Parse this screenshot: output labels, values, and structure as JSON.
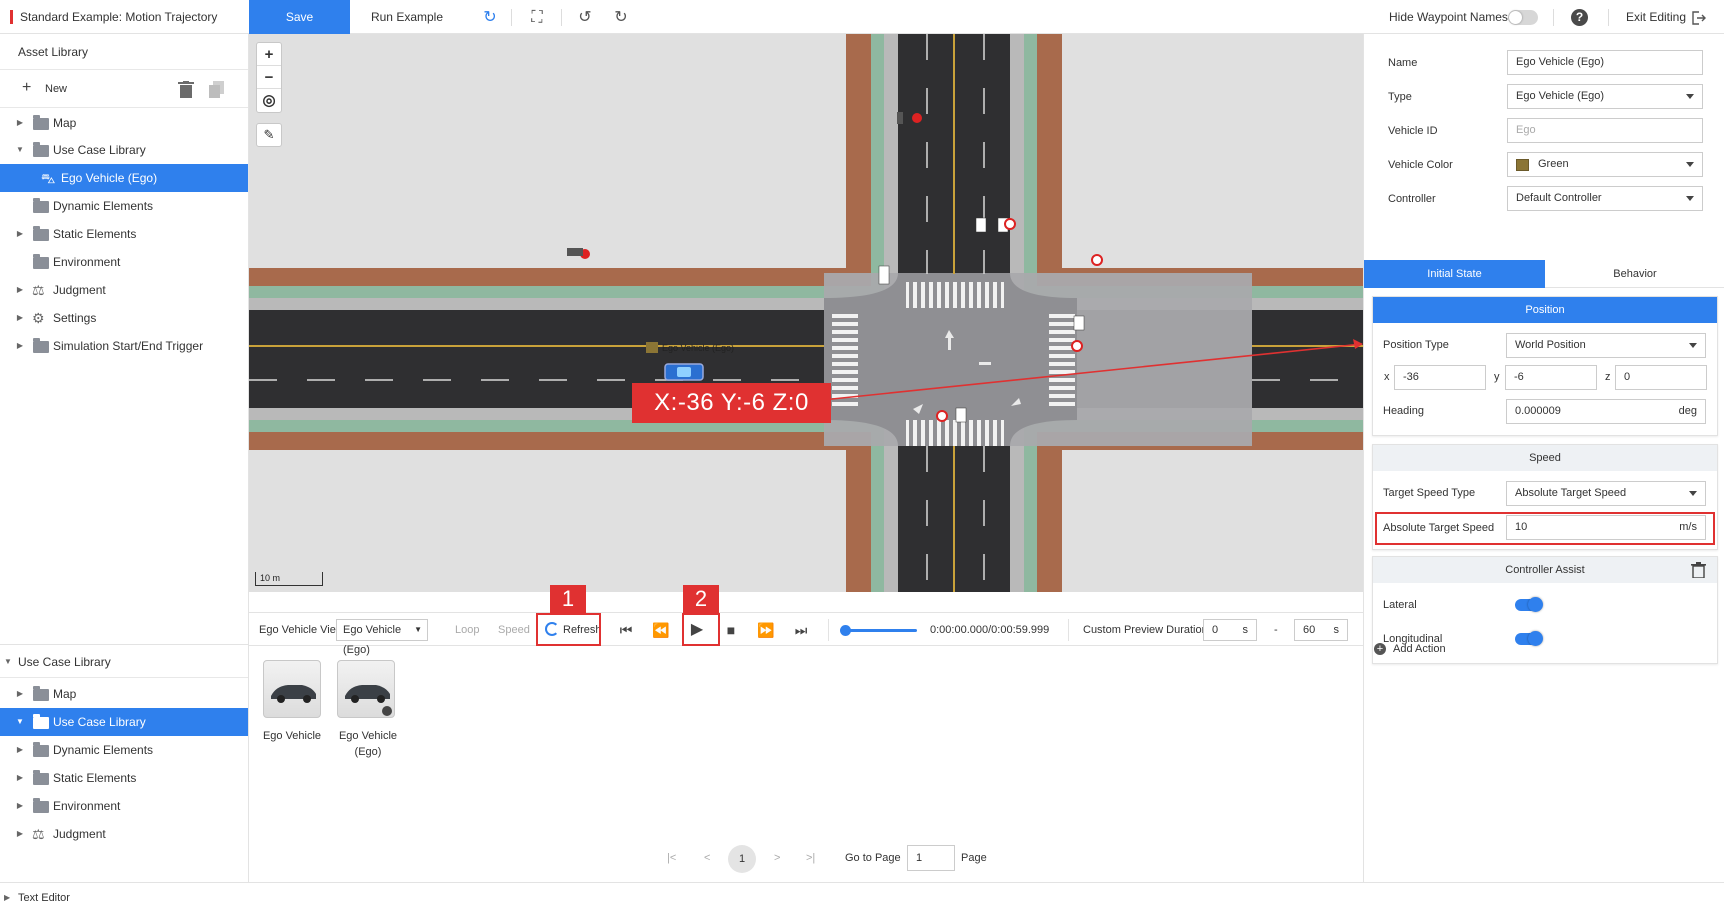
{
  "app": {
    "doc_title": "Standard Example: Motion Trajectory",
    "save_label": "Save",
    "run_label": "Run Example",
    "hide_waypoint_label": "Hide Waypoint Names",
    "hide_waypoint_on": false,
    "help_label": "?",
    "exit_label": "Exit Editing"
  },
  "left_top": {
    "title": "Asset Library",
    "new_label": "New",
    "items": [
      {
        "label": "Map"
      },
      {
        "label": "Use Case Library"
      },
      {
        "label": "Ego Vehicle (Ego)"
      },
      {
        "label": "Dynamic Elements"
      },
      {
        "label": "Static Elements"
      },
      {
        "label": "Environment"
      },
      {
        "label": "Judgment"
      },
      {
        "label": "Settings"
      },
      {
        "label": "Simulation Start/End Trigger"
      }
    ]
  },
  "left_bottom": {
    "title": "Use Case Library",
    "items": [
      {
        "label": "Map"
      },
      {
        "label": "Use Case Library"
      },
      {
        "label": "Dynamic Elements"
      },
      {
        "label": "Static Elements"
      },
      {
        "label": "Environment"
      },
      {
        "label": "Judgment"
      }
    ]
  },
  "map": {
    "zoom_in": "+",
    "zoom_out": "−",
    "scale": "10 m",
    "vehicle_label": "Ego Vehicle (Ego)",
    "coord_readout": "X:-36  Y:-6  Z:0"
  },
  "preview": {
    "view_label": "Ego Vehicle View",
    "view_value": "Ego Vehicle (Ego)",
    "loop_label": "Loop",
    "speed_label": "Speed",
    "refresh_label": "Refresh",
    "marker1": "1",
    "marker2": "2",
    "time": "0:00:00.000/0:00:59.999",
    "custom_label": "Custom Preview Duration",
    "start_value": "0",
    "end_value": "60",
    "unit": "s",
    "dash": "-"
  },
  "assets": [
    {
      "label": "Ego Vehicle"
    },
    {
      "label": "Ego Vehicle (Ego)"
    }
  ],
  "pager": {
    "page": "1",
    "goto_label": "Go to Page",
    "goto_value": "1",
    "page_suffix": "Page"
  },
  "text_editor": "Text Editor",
  "props": {
    "name_label": "Name",
    "name_value": "Ego Vehicle (Ego)",
    "type_label": "Type",
    "type_value": "Ego Vehicle (Ego)",
    "vid_label": "Vehicle ID",
    "vid_placeholder": "Ego",
    "color_label": "Vehicle Color",
    "color_value": "Green",
    "color_swatch": "#8b7535",
    "controller_label": "Controller",
    "controller_value": "Default Controller",
    "tab_initial": "Initial State",
    "tab_behavior": "Behavior",
    "position": {
      "title": "Position",
      "type_label": "Position Type",
      "type_value": "World Position",
      "x_label": "x",
      "x_value": "-36",
      "y_label": "y",
      "y_value": "-6",
      "z_label": "z",
      "z_value": "0",
      "heading_label": "Heading",
      "heading_value": "0.000009",
      "heading_unit": "deg"
    },
    "speed": {
      "title": "Speed",
      "type_label": "Target Speed Type",
      "type_value": "Absolute Target Speed",
      "abs_label": "Absolute Target Speed",
      "abs_value": "10",
      "abs_unit": "m/s"
    },
    "controller_assist": {
      "title": "Controller Assist",
      "lateral_label": "Lateral",
      "lateral_on": true,
      "longitudinal_label": "Longitudinal",
      "longitudinal_on": true
    },
    "add_action": "Add Action"
  },
  "colors": {
    "accent": "#2f80ed",
    "highlight": "#e03131"
  }
}
